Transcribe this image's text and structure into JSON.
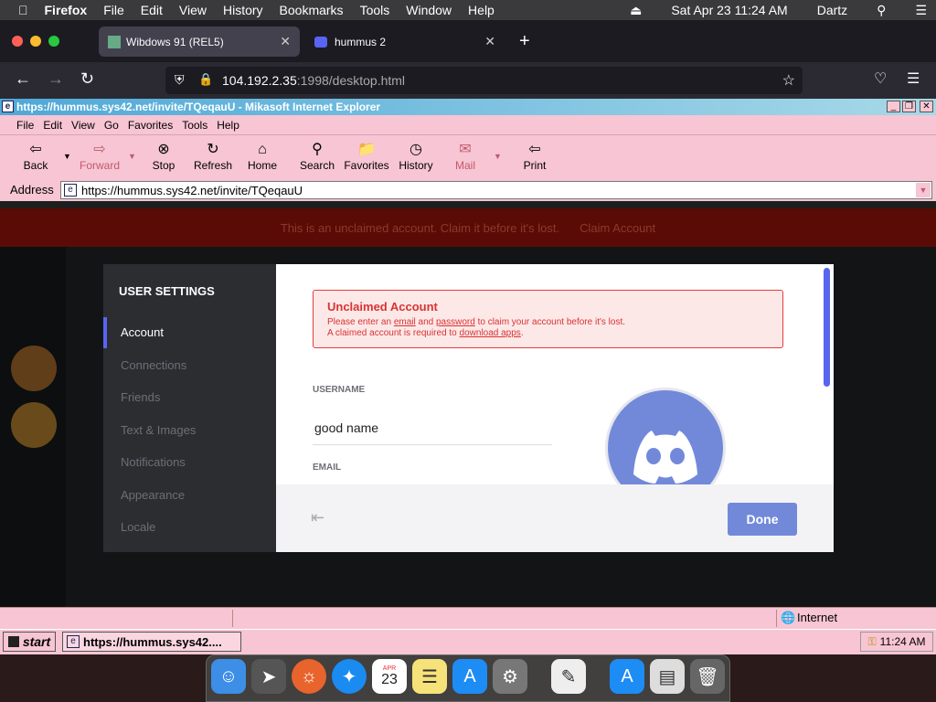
{
  "mac_menubar": {
    "app": "Firefox",
    "menus": [
      "File",
      "Edit",
      "View",
      "History",
      "Bookmarks",
      "Tools",
      "Window",
      "Help"
    ],
    "datetime": "Sat Apr 23  11:24 AM",
    "user": "Dartz"
  },
  "firefox": {
    "tabs": [
      {
        "label": "Wibdows 91 (REL5)",
        "active": true
      },
      {
        "label": "hummus 2",
        "active": false
      }
    ],
    "url_host": "104.192.2.35",
    "url_path": ":1998/desktop.html"
  },
  "ie": {
    "title": "https://hummus.sys42.net/invite/TQeqauU - Mikasoft Internet Explorer",
    "menus": [
      "File",
      "Edit",
      "View",
      "Go",
      "Favorites",
      "Tools",
      "Help"
    ],
    "toolbar": [
      {
        "label": "Back",
        "icon": "back-arrow-icon"
      },
      {
        "label": "Forward",
        "icon": "forward-arrow-icon"
      },
      {
        "label": "Stop",
        "icon": "stop-icon"
      },
      {
        "label": "Refresh",
        "icon": "refresh-icon"
      },
      {
        "label": "Home",
        "icon": "home-icon"
      },
      {
        "label": "Search",
        "icon": "search-icon"
      },
      {
        "label": "Favorites",
        "icon": "favorites-icon"
      },
      {
        "label": "History",
        "icon": "history-icon"
      },
      {
        "label": "Mail",
        "icon": "mail-icon"
      },
      {
        "label": "Print",
        "icon": "print-icon"
      }
    ],
    "address_label": "Address",
    "address": "https://hummus.sys42.net/invite/TQeqauU",
    "status_zone": "Internet"
  },
  "page": {
    "banner_text": "This is an unclaimed account. Claim it before it's lost.",
    "banner_button": "Claim Account",
    "settings": {
      "header": "USER SETTINGS",
      "items": [
        "Account",
        "Connections",
        "Friends",
        "Text & Images",
        "Notifications",
        "Appearance",
        "Locale"
      ],
      "selected": "Account"
    },
    "alert": {
      "title": "Unclaimed Account",
      "line1_a": "Please enter an ",
      "line1_email": "email",
      "line1_b": " and ",
      "line1_password": "password",
      "line1_c": " to claim your account before it's lost.",
      "line2_a": "A claimed account is required to ",
      "line2_link": "download apps",
      "line2_b": "."
    },
    "username_label": "USERNAME",
    "username_value": "good name",
    "email_label": "EMAIL",
    "done_label": "Done"
  },
  "taskbar": {
    "start": "start",
    "item": "https://hummus.sys42....",
    "clock": "11:24 AM"
  },
  "dock": {
    "calendar_month": "APR",
    "calendar_day": "23"
  }
}
